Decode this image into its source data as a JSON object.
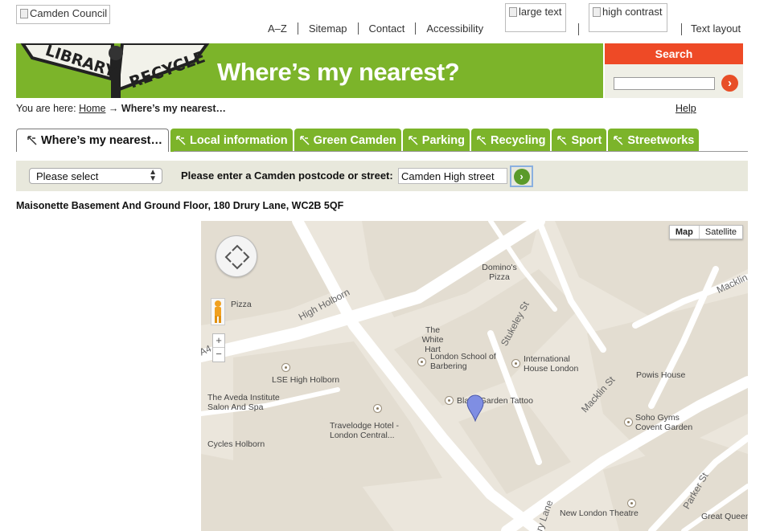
{
  "header": {
    "logo_alt": "Camden Council",
    "links": [
      "A–Z",
      "Sitemap",
      "Contact",
      "Accessibility"
    ],
    "large_text_alt": "large text",
    "high_contrast_alt": "high contrast",
    "text_layout": "Text layout"
  },
  "banner": {
    "title": "Where’s my nearest?",
    "sign_left": "LIBRARY",
    "sign_right": "RECYCLE"
  },
  "search": {
    "label": "Search",
    "value": "",
    "go_glyph": "›"
  },
  "breadcrumb": {
    "prefix": "You are here:",
    "home": "Home",
    "arrow": "→",
    "current": "Where’s my nearest…"
  },
  "help": "Help",
  "tabs": [
    {
      "label": "Where’s my nearest…",
      "active": true
    },
    {
      "label": "Local information",
      "active": false
    },
    {
      "label": "Green Camden",
      "active": false
    },
    {
      "label": "Parking",
      "active": false
    },
    {
      "label": "Recycling",
      "active": false
    },
    {
      "label": "Sport",
      "active": false
    },
    {
      "label": "Streetworks",
      "active": false
    }
  ],
  "filter": {
    "select_value": "Please select",
    "postcode_label": "Please enter a Camden postcode or street:",
    "postcode_value": "Camden High street",
    "go_glyph": "›"
  },
  "address": "Maisonette Basement And Ground Floor, 180 Drury Lane, WC2B 5QF",
  "map": {
    "type_buttons": [
      "Map",
      "Satellite"
    ],
    "selected_type": "Map",
    "zoom_in": "+",
    "zoom_out": "−",
    "streets": [
      "High Holborn",
      "Stukeley St",
      "Macklin St",
      "Parker St",
      "Drury Lane",
      "A4",
      "Macklin"
    ],
    "places": [
      "Domino's Pizza",
      "The White Hart",
      "London School of Barbering",
      "International House London",
      "Powis House",
      "LSE High Holborn",
      "The Aveda Institute Salon And Spa",
      "Travelodge Hotel - London Central...",
      "Black Garden Tattoo",
      "Soho Gyms Covent Garden",
      "New London Theatre",
      "Great Queen",
      "Cycles Holborn",
      "Pizza"
    ],
    "colors": {
      "road": "#ffffff",
      "block": "#e3ddd1",
      "background": "#ebe6dc",
      "marker": "#7f8ee3"
    }
  },
  "colors": {
    "green": "#7cb42a",
    "search_red": "#ee4a26"
  }
}
